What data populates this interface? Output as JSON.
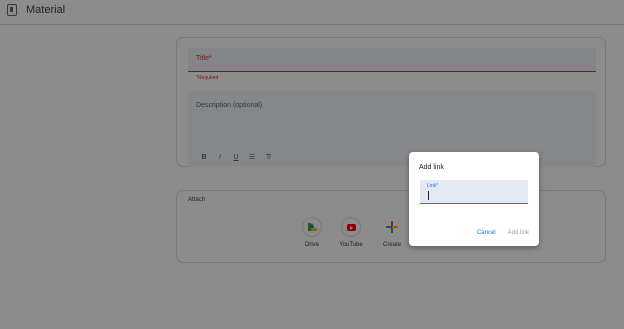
{
  "header": {
    "title": "Material",
    "icon": "assignment-icon"
  },
  "form": {
    "title_placeholder": "Title*",
    "title_helper": "*Required",
    "description_placeholder": "Description (optional)",
    "format_buttons": [
      {
        "label": "B",
        "icon": "bold-icon"
      },
      {
        "label": "I",
        "icon": "italic-icon"
      },
      {
        "label": "U",
        "icon": "underline-icon"
      },
      {
        "label": "☰",
        "icon": "bulleted-list-icon"
      },
      {
        "label": "T̸",
        "icon": "clear-format-icon"
      }
    ]
  },
  "attach": {
    "title": "Attach",
    "options": [
      {
        "label": "Drive",
        "icon": "google-drive-icon"
      },
      {
        "label": "YouTube",
        "icon": "youtube-icon"
      },
      {
        "label": "Create",
        "icon": "create-plus-icon"
      }
    ]
  },
  "dialog": {
    "title": "Add link",
    "field_label": "Link*",
    "field_value": "",
    "cancel_label": "Cancel",
    "add_label": "Add link"
  },
  "colors": {
    "error": "#d93025",
    "accent": "#1a73e8",
    "disabled": "#9aa0a6",
    "overlay": "rgba(0,0,0,0.45)"
  }
}
